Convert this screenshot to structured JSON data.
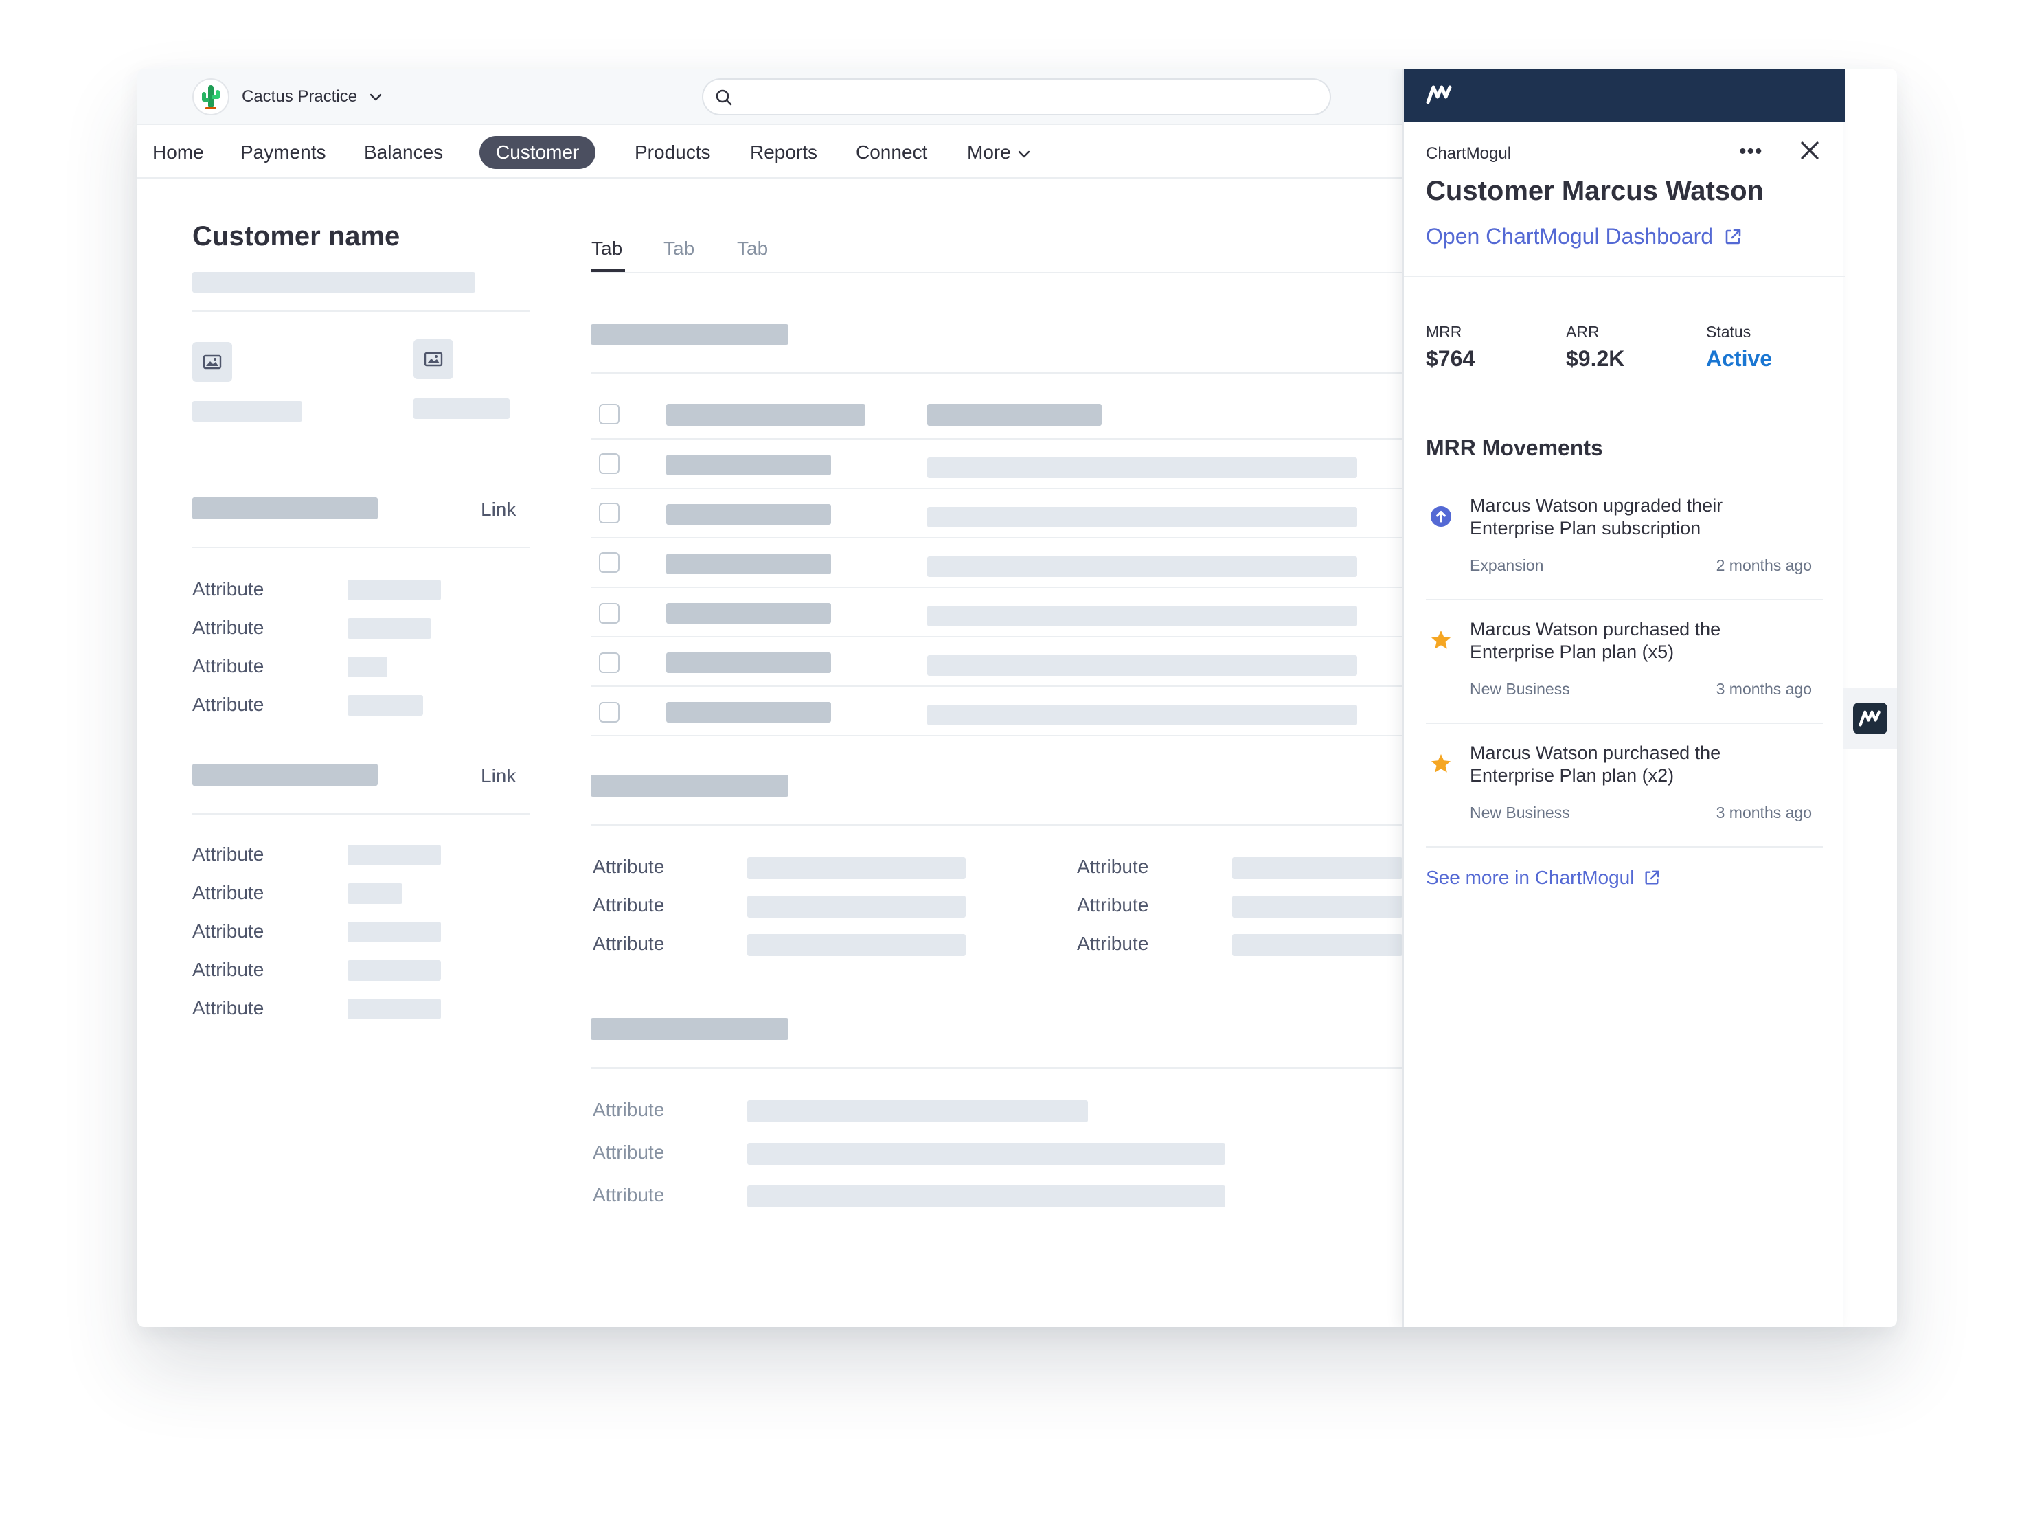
{
  "account": {
    "name": "Cactus Practice"
  },
  "nav": {
    "items": [
      {
        "label": "Home"
      },
      {
        "label": "Payments"
      },
      {
        "label": "Balances"
      },
      {
        "label": "Customer"
      },
      {
        "label": "Products"
      },
      {
        "label": "Reports"
      },
      {
        "label": "Connect"
      },
      {
        "label": "More"
      }
    ]
  },
  "customer": {
    "title": "Customer name",
    "link_1": "Link",
    "link_2": "Link",
    "attrs_1": [
      "Attribute",
      "Attribute",
      "Attribute",
      "Attribute"
    ],
    "attrs_2": [
      "Attribute",
      "Attribute",
      "Attribute",
      "Attribute",
      "Attribute"
    ]
  },
  "tabs": [
    {
      "label": "Tab"
    },
    {
      "label": "Tab"
    },
    {
      "label": "Tab"
    }
  ],
  "details": {
    "left_attrs": [
      "Attribute",
      "Attribute",
      "Attribute"
    ],
    "right_attrs": [
      "Attribute",
      "Attribute",
      "Attribute"
    ],
    "bottom_attrs": [
      "Attribute",
      "Attribute",
      "Attribute"
    ]
  },
  "panel": {
    "app_name": "ChartMogul",
    "more_glyph": "•••",
    "title": "Customer Marcus Watson",
    "dashboard_link": "Open ChartMogul Dashboard",
    "metrics": {
      "mrr_label": "MRR",
      "mrr_value": "$764",
      "arr_label": "ARR",
      "arr_value": "$9.2K",
      "status_label": "Status",
      "status_value": "Active"
    },
    "movements_title": "MRR Movements",
    "movements": [
      {
        "icon": "arrow-up-circle-icon",
        "text": "Marcus Watson upgraded their Enterprise Plan subscription",
        "tag": "Expansion",
        "time": "2 months ago"
      },
      {
        "icon": "star-icon",
        "text": "Marcus Watson purchased the Enterprise Plan plan (x5)",
        "tag": "New Business",
        "time": "3 months ago"
      },
      {
        "icon": "star-icon",
        "text": "Marcus Watson purchased the Enterprise Plan plan (x2)",
        "tag": "New Business",
        "time": "3 months ago"
      }
    ],
    "see_more": "See more in ChartMogul"
  },
  "colors": {
    "panel_header": "#1e3250",
    "link": "#5469d4",
    "status_active": "#1a76d2",
    "nav_active": "#4b4f60",
    "skeleton_light": "#e3e8ee",
    "skeleton_dark": "#c1c9d2",
    "star": "#f5a623"
  }
}
